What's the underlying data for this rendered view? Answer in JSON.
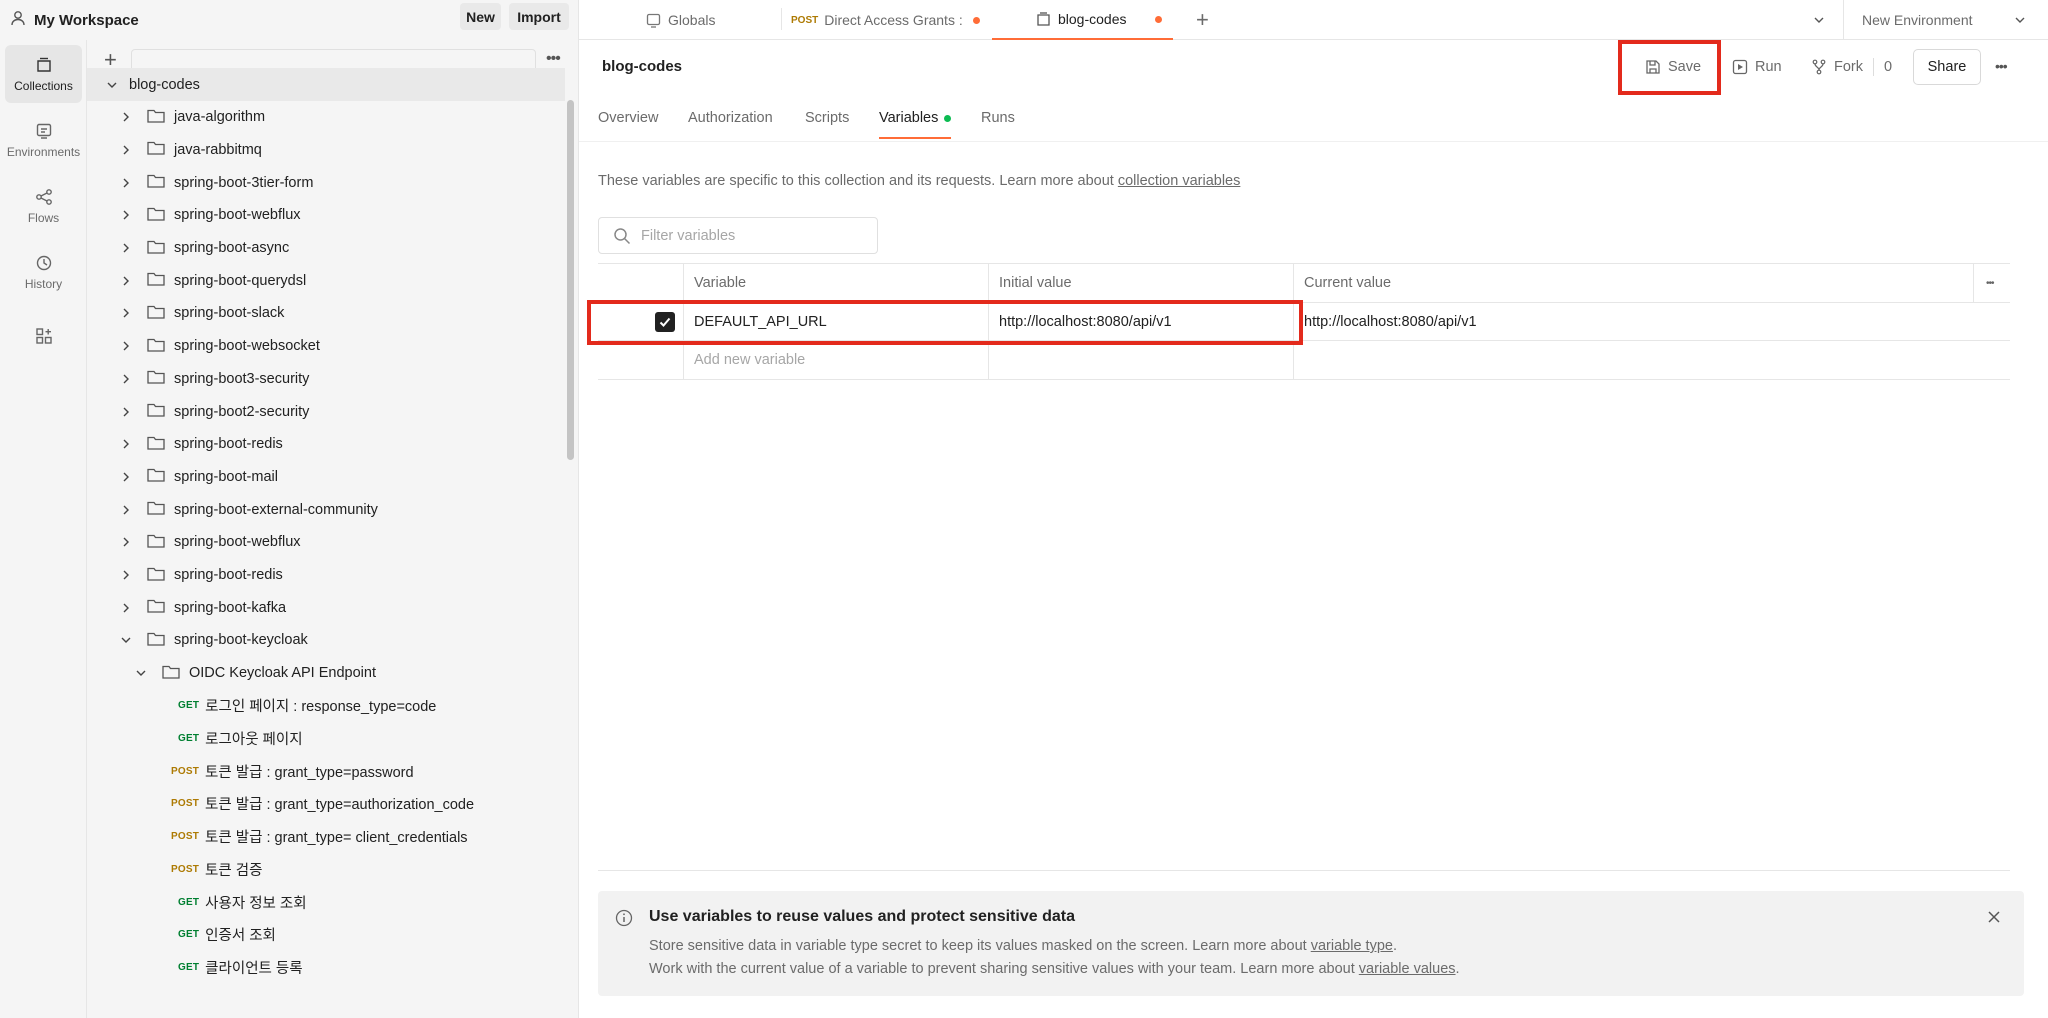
{
  "workspace": {
    "name": "My Workspace",
    "new_label": "New",
    "import_label": "Import"
  },
  "tabs": [
    {
      "label": "Globals"
    },
    {
      "method": "POST",
      "label": "Direct Access Grants :"
    },
    {
      "label": "blog-codes"
    }
  ],
  "environment": {
    "label": "New Environment"
  },
  "rail": [
    {
      "label": "Collections"
    },
    {
      "label": "Environments"
    },
    {
      "label": "Flows"
    },
    {
      "label": "History"
    }
  ],
  "tree": {
    "root": "blog-codes",
    "folders": [
      "java-algorithm",
      "java-rabbitmq",
      "spring-boot-3tier-form",
      "spring-boot-webflux",
      "spring-boot-async",
      "spring-boot-querydsl",
      "spring-boot-slack",
      "spring-boot-websocket",
      "spring-boot3-security",
      "spring-boot2-security",
      "spring-boot-redis",
      "spring-boot-mail",
      "spring-boot-external-community",
      "spring-boot-webflux",
      "spring-boot-redis",
      "spring-boot-kafka",
      "spring-boot-keycloak"
    ],
    "subfolder": "OIDC Keycloak API Endpoint",
    "requests": [
      {
        "method": "GET",
        "name": "로그인 페이지 : response_type=code"
      },
      {
        "method": "GET",
        "name": "로그아웃 페이지"
      },
      {
        "method": "POST",
        "name": "토큰 발급 : grant_type=password"
      },
      {
        "method": "POST",
        "name": "토큰 발급 : grant_type=authorization_code"
      },
      {
        "method": "POST",
        "name": "토큰 발급 : grant_type= client_credentials"
      },
      {
        "method": "POST",
        "name": "토큰 검증"
      },
      {
        "method": "GET",
        "name": "사용자 정보 조회"
      },
      {
        "method": "GET",
        "name": "인증서 조회"
      },
      {
        "method": "GET",
        "name": "클라이언트 등록"
      }
    ]
  },
  "main": {
    "title": "blog-codes",
    "save_label": "Save",
    "run_label": "Run",
    "fork_label": "Fork",
    "fork_count": "0",
    "share_label": "Share",
    "subtabs": [
      "Overview",
      "Authorization",
      "Scripts",
      "Variables",
      "Runs"
    ],
    "description": "These variables are specific to this collection and its requests. Learn more about ",
    "description_link": "collection variables",
    "filter_placeholder": "Filter variables",
    "table": {
      "headers": [
        "Variable",
        "Initial value",
        "Current value"
      ],
      "rows": [
        {
          "checked": true,
          "variable": "DEFAULT_API_URL",
          "initial": "http://localhost:8080/api/v1",
          "current": "http://localhost:8080/api/v1"
        }
      ],
      "add_placeholder": "Add new variable"
    },
    "banner": {
      "title": "Use variables to reuse values and protect sensitive data",
      "line1": "Store sensitive data in variable type secret to keep its values masked on the screen. Learn more about ",
      "line1_link": "variable type",
      "line1_end": ".",
      "line2": "Work with the current value of a variable to prevent sharing sensitive values with your team. Learn more about ",
      "line2_link": "variable values",
      "line2_end": "."
    }
  }
}
